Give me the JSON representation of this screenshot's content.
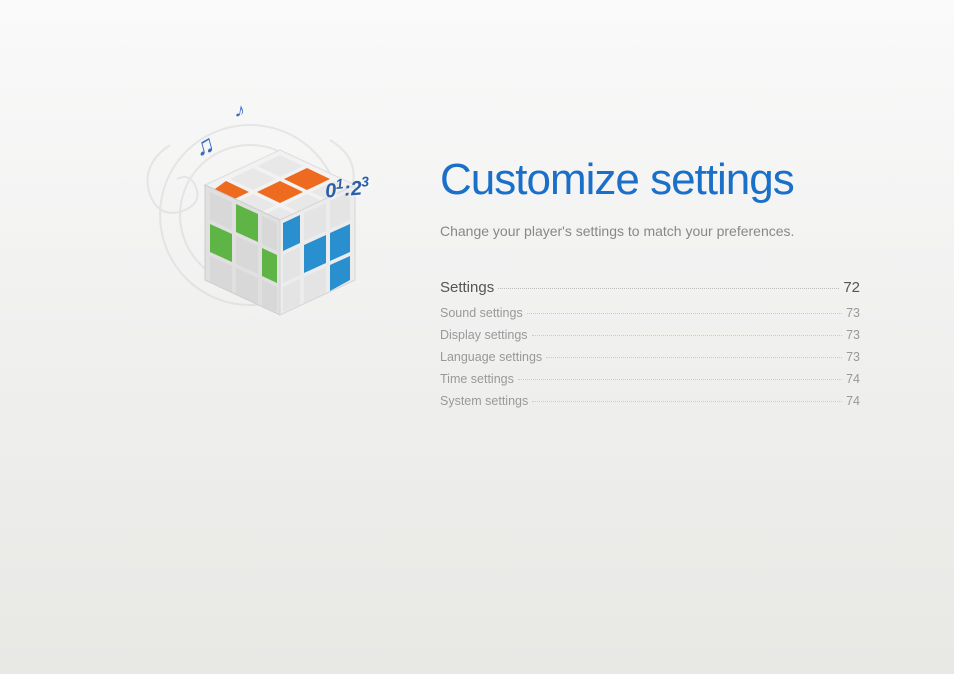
{
  "title": "Customize settings",
  "subtitle": "Change your player's settings to match your preferences.",
  "graphic": {
    "timecode": "01:23",
    "note1": "♫",
    "note2": "♪"
  },
  "toc": {
    "main": {
      "label": "Settings",
      "page": "72"
    },
    "items": [
      {
        "label": "Sound settings",
        "page": "73"
      },
      {
        "label": "Display settings",
        "page": "73"
      },
      {
        "label": "Language settings",
        "page": "73"
      },
      {
        "label": "Time settings",
        "page": "74"
      },
      {
        "label": "System settings",
        "page": "74"
      }
    ]
  }
}
